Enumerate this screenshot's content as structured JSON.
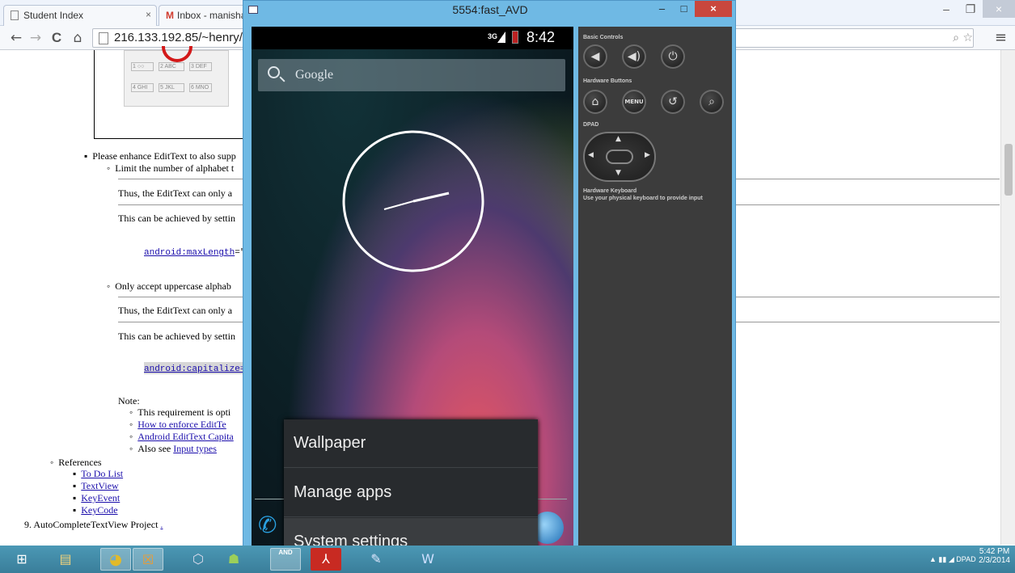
{
  "browser": {
    "tabs": [
      {
        "label": "Student Index",
        "close": "×"
      },
      {
        "label": "Inbox - manisha.v",
        "close": ""
      }
    ],
    "url": "216.133.192.85/~henry/",
    "nav": {
      "back": "←",
      "forward": "→",
      "reload": "C",
      "home": "⌂"
    },
    "window_controls": {
      "min": "–",
      "max": "❐",
      "close": "×"
    }
  },
  "page": {
    "keypad_keys": [
      "1 ○○",
      "2 ABC",
      "3 DEF",
      "4 GHI",
      "5 JKL",
      "6 MNO"
    ],
    "bullet_enhance": "Please enhance EditText to also supp",
    "limit_alpha": "Limit the number of alphabet t",
    "thus1": "Thus, the EditText can only a",
    "achieved1": "This can be achieved by settin",
    "code1": "android:maxLength",
    "code1_suffix": "=\"",
    "uppercase": "Only accept uppercase alphab",
    "thus2": "Thus, the EditText can only a",
    "achieved2": "This can be achieved by settin",
    "code2": "android:capitalize=",
    "note": "Note:",
    "note_items": [
      {
        "text": "This requirement is opti",
        "link": false
      },
      {
        "text": "How to enforce EditTe",
        "link": true
      },
      {
        "text": "Android EditText Capita",
        "link": true
      }
    ],
    "also_see_prefix": "Also see ",
    "also_see_link": "Input types",
    "references": "References",
    "ref_links": [
      "To Do List",
      "TextView",
      "KeyEvent",
      "KeyCode"
    ],
    "item9": "9.  AutoCompleteTextView Project ",
    "item9_link": "."
  },
  "emulator": {
    "title": "5554:fast_AVD",
    "window_controls": {
      "min": "–",
      "max": "□",
      "close": "×"
    },
    "status_time": "8:42",
    "network": "3G",
    "search_placeholder": "Google",
    "menu_items": [
      "Wallpaper",
      "Manage apps",
      "System settings"
    ],
    "panel": {
      "basic_controls": "Basic Controls",
      "hardware_buttons": "Hardware Buttons",
      "dpad": "DPAD",
      "keyboard_title": "Hardware Keyboard",
      "keyboard_desc": "Use your physical keyboard to provide input",
      "menu_label": "MENU"
    }
  },
  "taskbar": {
    "time": "5:42 PM",
    "date": "2/3/2014",
    "ie_label": "DPAD",
    "and_label": "AND"
  }
}
